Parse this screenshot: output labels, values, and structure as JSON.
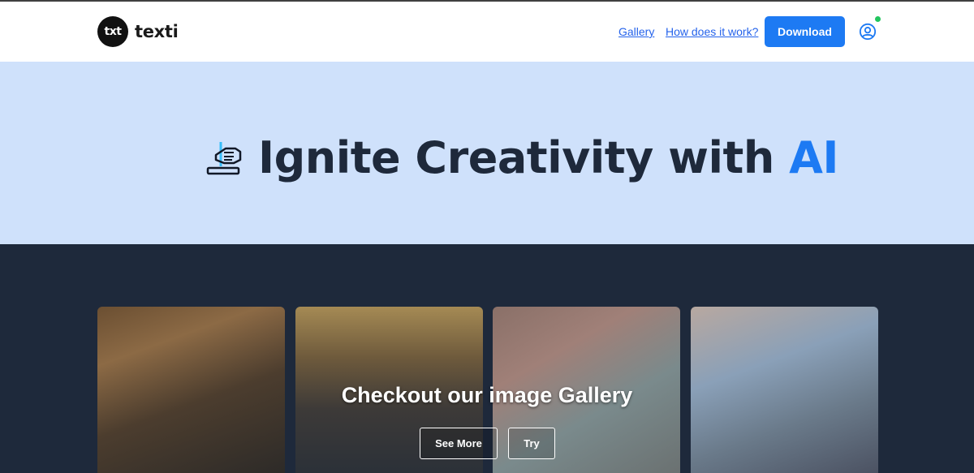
{
  "header": {
    "logo_badge": "txt",
    "logo_text": "texti",
    "nav": {
      "gallery": "Gallery",
      "how": "How does it work?"
    },
    "download_label": "Download",
    "user_icon": "user-circle-icon",
    "status_color": "#22c55e"
  },
  "hero": {
    "title_main": "Ignite Creativity with ",
    "title_accent": "AI",
    "icon": "hand-writing-icon",
    "background": "#cfe1fb",
    "accent_color": "#1d7af3"
  },
  "gallery": {
    "title": "Checkout our image Gallery",
    "see_more": "See More",
    "try": "Try",
    "background": "#1e293b"
  }
}
